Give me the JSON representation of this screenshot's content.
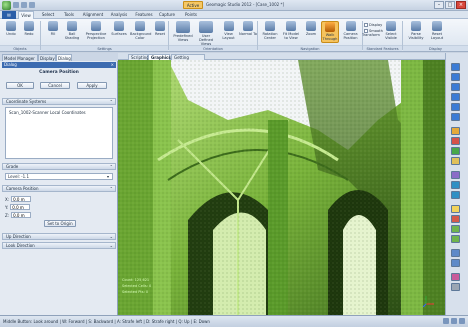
{
  "titlebar": {
    "active_label": "Active",
    "window_title": "Geomagic Studio 2012 - [Case_1002 *]"
  },
  "ribbon_tabs": [
    "View",
    "Select",
    "Tools",
    "Alignment",
    "Analysis",
    "Features",
    "Capture",
    "Points"
  ],
  "ribbon_selected_tab": "View",
  "ribbon": {
    "buttons": [
      {
        "label": "Undo"
      },
      {
        "label": "Redo"
      },
      {
        "label": "Fill"
      },
      {
        "label": "Ball Shading"
      },
      {
        "label": "Perspective Projection"
      },
      {
        "label": "Surfaces"
      },
      {
        "label": "Background Color"
      },
      {
        "label": "Reset"
      },
      {
        "label": "Predefined Views"
      },
      {
        "label": "User Defined Views"
      },
      {
        "label": "View Layout"
      },
      {
        "label": "Normal To"
      },
      {
        "label": "Rotation Center"
      },
      {
        "label": "Fit Model to View"
      },
      {
        "label": "Zoom"
      },
      {
        "label": "Walk Through"
      },
      {
        "label": "Camera Position"
      },
      {
        "label": "Transform"
      },
      {
        "label": "Select Visible"
      },
      {
        "label": "Parse Visibility"
      },
      {
        "label": "Reset Layout"
      }
    ],
    "groups": [
      "Objects",
      "Settings",
      "Orientation",
      "Navigation",
      "Standard Features",
      "Display"
    ],
    "checks": [
      "Display",
      "Smooth"
    ]
  },
  "panel": {
    "tabs": [
      "Model Manager",
      "Display",
      "Dialog"
    ],
    "selected_tab": "Dialog",
    "dialog_title": "Dialog",
    "close_glyph": "×",
    "heading": "Camera Position",
    "buttons": {
      "ok": "OK",
      "cancel": "Cancel",
      "apply": "Apply"
    },
    "coord_section": "Coordinate Systems",
    "coord_item": "Scan_1002-Scanner Local Coordinates",
    "grade_section": "Grade",
    "grade_value": "Level: -1.1",
    "camera_section": "Camera Position",
    "x_label": "X:",
    "x_value": "0.0 m",
    "y_label": "Y:",
    "y_value": "0.0 m",
    "z_label": "Z:",
    "z_value": "0.0 m",
    "set_origin": "Set to Origin",
    "up_direction": "Up Direction",
    "look_direction": "Look Direction",
    "chevron": "⌃"
  },
  "viewport": {
    "tabs": [
      "Scripting",
      "Graphics",
      "Getting Started"
    ],
    "selected_tab": "Graphics",
    "readout1": "Count: 125,621",
    "readout2": "Selected Cells: 0",
    "readout3": "Selected Pts: 0"
  },
  "statusbar": {
    "text": "Middle Button: Look around | W: Forward | S: Backward | A: Strafe left | D: Strafe right | Q: Up | E: Down"
  },
  "colors": {
    "scan_green": "#7fbf3d",
    "scan_dark": "#2a4a15",
    "accent": "#f6c35d"
  }
}
